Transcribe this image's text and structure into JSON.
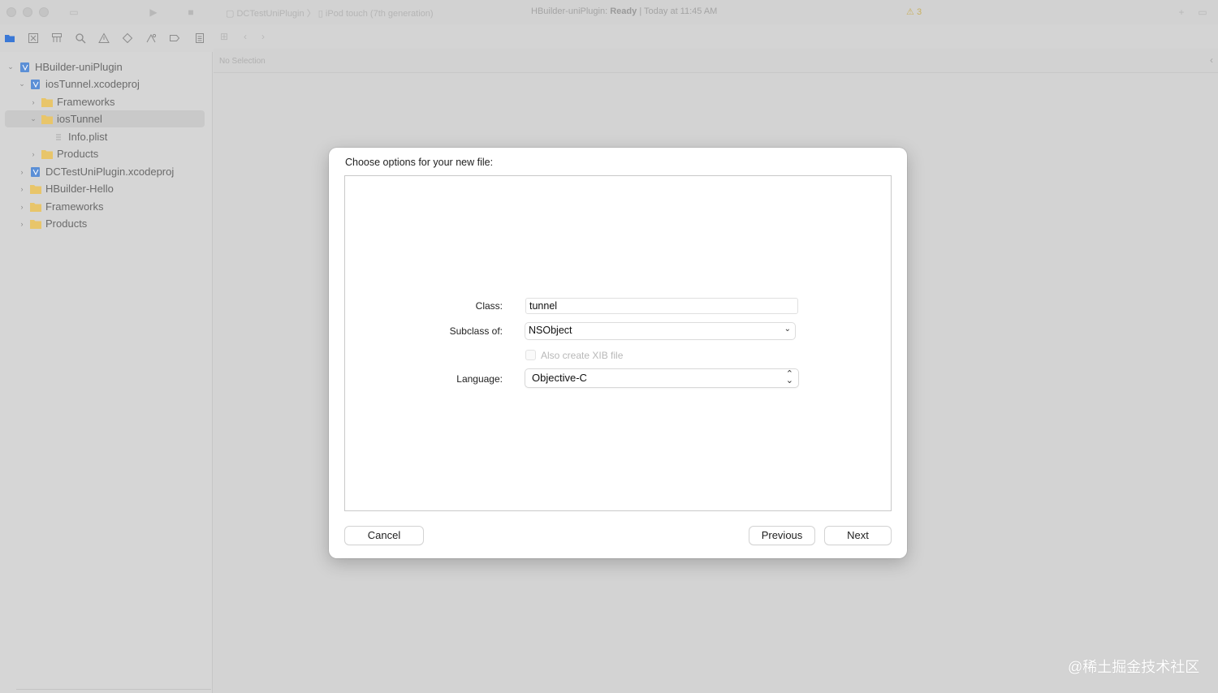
{
  "titlebar": {
    "scheme_target": "DCTestUniPlugin",
    "scheme_separator": "〉",
    "device": "iPod touch (7th generation)",
    "status_project": "HBuilder-uniPlugin:",
    "status_state": "Ready",
    "status_time": "| Today at 11:45 AM",
    "warning_count": "3"
  },
  "navigator_icons": [
    "folder-icon",
    "source-control-icon",
    "symbol-icon",
    "search-icon",
    "warning-icon",
    "test-diamond-icon",
    "debug-icon",
    "breakpoint-icon",
    "report-icon"
  ],
  "jumpbar": {
    "no_selection": "No Selection"
  },
  "project_tree": [
    {
      "label": "HBuilder-uniPlugin",
      "icon": "project-icon",
      "disclosure": "⌄"
    },
    {
      "label": "iosTunnel.xcodeproj",
      "icon": "project-icon",
      "disclosure": "⌄"
    },
    {
      "label": "Frameworks",
      "icon": "folder-icon",
      "disclosure": "›"
    },
    {
      "label": "iosTunnel",
      "icon": "folder-icon",
      "disclosure": "⌄"
    },
    {
      "label": "Info.plist",
      "icon": "plist-icon",
      "disclosure": ""
    },
    {
      "label": "Products",
      "icon": "folder-icon",
      "disclosure": "›"
    },
    {
      "label": "DCTestUniPlugin.xcodeproj",
      "icon": "project-icon",
      "disclosure": "›"
    },
    {
      "label": "HBuilder-Hello",
      "icon": "folder-icon",
      "disclosure": "›"
    },
    {
      "label": "Frameworks",
      "icon": "folder-icon",
      "disclosure": "›"
    },
    {
      "label": "Products",
      "icon": "folder-icon",
      "disclosure": "›"
    }
  ],
  "dialog": {
    "title": "Choose options for your new file:",
    "class_label": "Class:",
    "class_value": "tunnel",
    "subclass_label": "Subclass of:",
    "subclass_value": "NSObject",
    "xib_label": "Also create XIB file",
    "language_label": "Language:",
    "language_value": "Objective-C",
    "cancel": "Cancel",
    "previous": "Previous",
    "next": "Next"
  },
  "watermark": "@稀土掘金技术社区",
  "colors": {
    "folder": "#e8c56a",
    "project": "#5b8fd6",
    "accent": "#3a78d6"
  }
}
